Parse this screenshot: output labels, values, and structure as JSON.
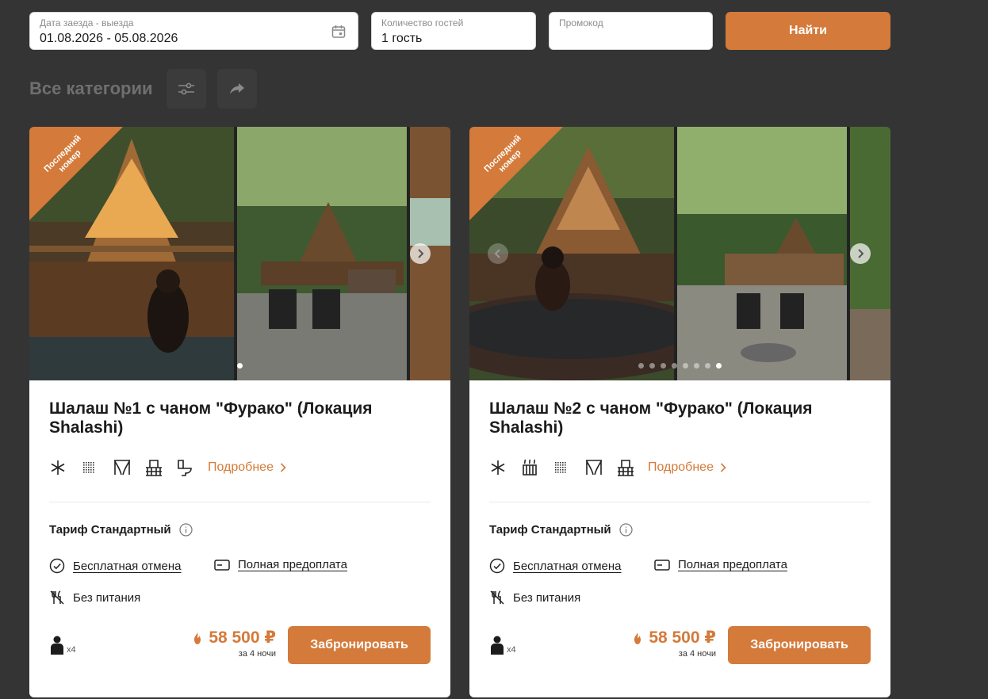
{
  "search": {
    "dates": {
      "label": "Дата заезда - выезда",
      "value": "01.08.2026 - 05.08.2026"
    },
    "guests": {
      "label": "Количество гостей",
      "value": "1 гость"
    },
    "promo": {
      "label": "Промокод",
      "value": ""
    },
    "find_label": "Найти"
  },
  "category_title": "Все категории",
  "cards": [
    {
      "ribbon": "Последний номер",
      "title": "Шалаш №1 с чаном \"Фурако\" (Локация Shalashi)",
      "more_label": "Подробнее",
      "tariff": "Тариф Стандартный",
      "cancel": "Бесплатная отмена",
      "prepay": "Полная предоплата",
      "meal": "Без питания",
      "guests": "x4",
      "price": "58 500 ₽",
      "nights": "за 4 ночи",
      "book_label": "Забронировать"
    },
    {
      "ribbon": "Последний номер",
      "title": "Шалаш №2 с чаном \"Фурако\" (Локация Shalashi)",
      "more_label": "Подробнее",
      "tariff": "Тариф Стандартный",
      "cancel": "Бесплатная отмена",
      "prepay": "Полная предоплата",
      "meal": "Без питания",
      "guests": "x4",
      "price": "58 500 ₽",
      "nights": "за 4 ночи",
      "book_label": "Забронировать"
    }
  ],
  "colors": {
    "accent": "#d47a3a",
    "background": "#343434"
  }
}
